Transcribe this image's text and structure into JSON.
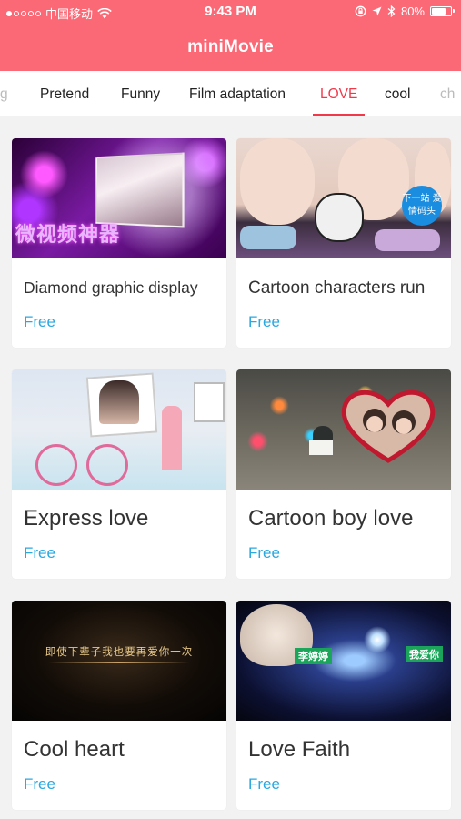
{
  "status_bar": {
    "carrier": "中国移动",
    "time": "9:43 PM",
    "battery": "80%",
    "battery_level": 0.8,
    "icons": [
      "signal-dots-icon",
      "wifi-icon",
      "rotation-lock-icon",
      "location-arrow-icon",
      "bluetooth-icon",
      "battery-icon"
    ]
  },
  "header": {
    "title": "miniMovie"
  },
  "tabs": [
    {
      "label": "g",
      "active": false
    },
    {
      "label": "Pretend",
      "active": false
    },
    {
      "label": "Funny",
      "active": false
    },
    {
      "label": "Film adaptation",
      "active": false
    },
    {
      "label": "LOVE",
      "active": true
    },
    {
      "label": "cool",
      "active": false
    },
    {
      "label": "ch",
      "active": false
    }
  ],
  "theme": {
    "header_bg": "#fb6976",
    "active_tab": "#f2394a",
    "price_color": "#2aa8e0"
  },
  "cards": [
    {
      "title": "Diamond graphic display",
      "price": "Free",
      "thumb_text": "微视频神器"
    },
    {
      "title": "Cartoon characters run",
      "price": "Free",
      "thumb_text": "下一站 爱情码头"
    },
    {
      "title": "Express love",
      "price": "Free"
    },
    {
      "title": "Cartoon boy love",
      "price": "Free"
    },
    {
      "title": "Cool heart",
      "price": "Free",
      "thumb_text": "即使下辈子我也要再爱你一次"
    },
    {
      "title": "Love Faith",
      "price": "Free",
      "thumb_text": "李婷婷",
      "thumb_text_2": "我爱你"
    }
  ]
}
